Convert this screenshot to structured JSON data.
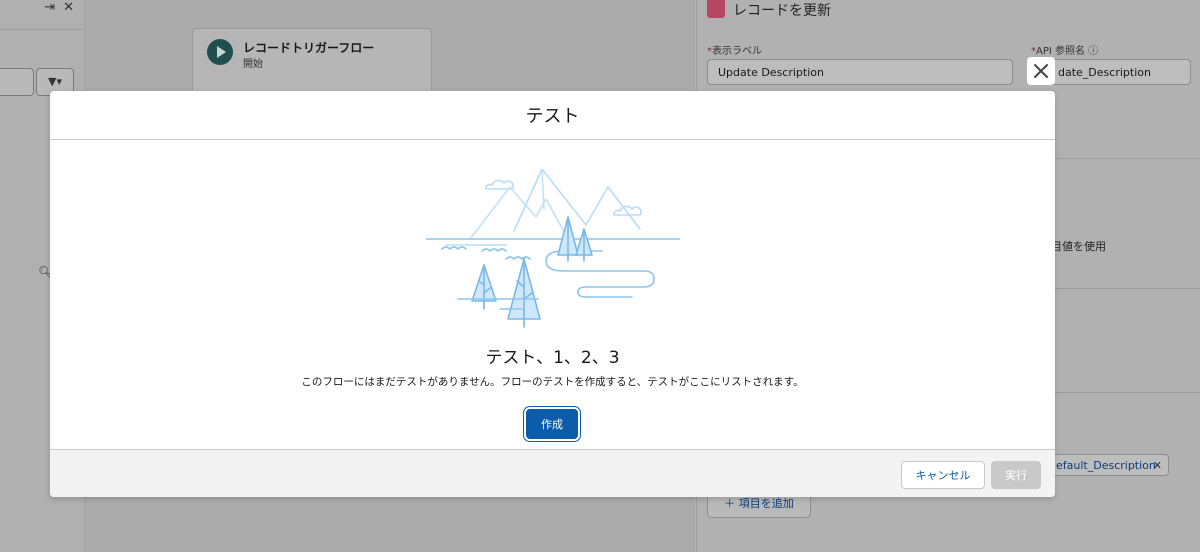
{
  "left_panel": {
    "collapse_icon": "collapse-right-icon",
    "close_icon": "close-icon",
    "filter_icon": "filter-icon",
    "search_icon": "search-icon"
  },
  "canvas": {
    "start_node": {
      "title": "レコードトリガーフロー",
      "subtitle": "開始"
    }
  },
  "right_panel": {
    "title": "レコードを更新",
    "label_field_label": "表示ラベル",
    "label_field_value": "Update Description",
    "api_field_label": "API 参照名",
    "api_field_value": "date_Description",
    "use_default_text": "目値を使用",
    "pill_text": "efault_Description",
    "add_item_label": "項目を追加"
  },
  "modal": {
    "title": "テスト",
    "empty_title": "テスト、1、2、3",
    "empty_description": "このフローにはまだテストがありません。フローのテストを作成すると、テストがここにリストされます。",
    "create_label": "作成",
    "cancel_label": "キャンセル",
    "run_label": "実行",
    "illustration_icon": "mountains-trees-illustration"
  },
  "colors": {
    "brand": "#0b5cab",
    "illustration_stroke": "#7ab8e8",
    "illustration_fill": "#a8d4f5"
  }
}
